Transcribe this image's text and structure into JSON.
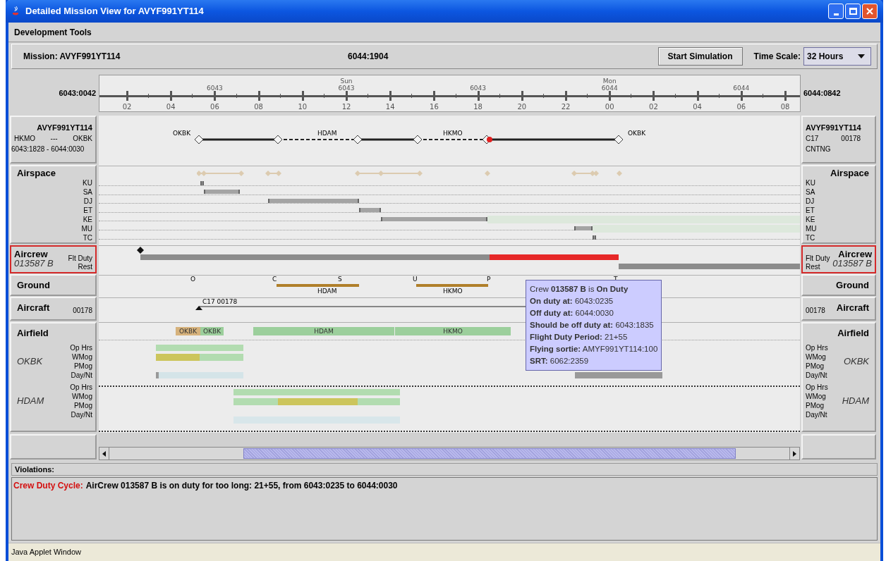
{
  "window": {
    "title": "Detailed Mission View for AVYF991YT114"
  },
  "menu_bar": [
    {
      "label": "Development Tools"
    }
  ],
  "mission_bar": {
    "mission": "Mission: AVYF991YT114",
    "current_time": "6044:1904",
    "start_button": "Start Simulation",
    "time_scale_label": "Time Scale:",
    "time_scale_value": "32 Hours"
  },
  "timeline": {
    "start": "6043:0042",
    "end": "6044:0842",
    "dates": [
      {
        "date": "6043"
      },
      {
        "weekday": "Sun",
        "date": "6043"
      },
      {
        "date": "6043"
      },
      {
        "weekday": "Mon",
        "date": "6044"
      },
      {
        "date": "6044"
      }
    ],
    "hours": [
      "02",
      "04",
      "06",
      "08",
      "10",
      "12",
      "14",
      "16",
      "18",
      "20",
      "22",
      "00",
      "02",
      "04",
      "06",
      "08"
    ]
  },
  "left_panel": {
    "mission": {
      "id": "AVYF991YT114",
      "origin": "HKMO",
      "separator": "---",
      "destination": "OKBK",
      "period": "6043:1828 - 6044:0030"
    },
    "airspace": {
      "title": "Airspace",
      "codes": [
        "KU",
        "SA",
        "DJ",
        "ET",
        "KE",
        "MU",
        "TC"
      ]
    },
    "aircrew": {
      "title": "Aircrew",
      "crew_id": "013587 B",
      "rows": [
        "Flt Duty",
        "Rest"
      ],
      "highlighted": true
    },
    "ground": {
      "title": "Ground"
    },
    "aircraft": {
      "title": "Aircraft",
      "tail": "00178"
    },
    "airfield": {
      "title": "Airfield",
      "fields": [
        {
          "name": "OKBK",
          "rows": [
            "Op Hrs",
            "WMog",
            "PMog",
            "Day/Nt"
          ]
        },
        {
          "name": "HDAM",
          "rows": [
            "Op Hrs",
            "WMog",
            "PMog",
            "Day/Nt"
          ]
        }
      ]
    }
  },
  "right_panel": {
    "mission": {
      "id": "AVYF991YT114",
      "type": "C17",
      "tail": "00178",
      "status": "CNTNG"
    },
    "airspace": {
      "title": "Airspace",
      "codes": [
        "KU",
        "SA",
        "DJ",
        "ET",
        "KE",
        "MU",
        "TC"
      ]
    },
    "aircrew": {
      "title": "Aircrew",
      "crew_id": "013587 B",
      "rows": [
        "Flt Duty",
        "Rest"
      ],
      "highlighted": true
    },
    "ground": {
      "title": "Ground"
    },
    "aircraft": {
      "title": "Aircraft",
      "tail": "00178"
    },
    "airfield": {
      "title": "Airfield",
      "fields": [
        {
          "name": "OKBK",
          "rows": [
            "Op Hrs",
            "WMog",
            "PMog",
            "Day/Nt"
          ]
        },
        {
          "name": "HDAM",
          "rows": [
            "Op Hrs",
            "WMog",
            "PMog",
            "Day/Nt"
          ]
        }
      ]
    }
  },
  "gantt": {
    "route_stops": [
      "OKBK",
      "HDAM",
      "HKMO",
      "OKBK"
    ],
    "ground_events": [
      "O",
      "C",
      "S",
      "U",
      "P",
      "T"
    ],
    "ground_stations": [
      "HDAM",
      "HKMO"
    ],
    "aircraft_label": "C17 00178",
    "airfield_tags": [
      {
        "label": "OKBK",
        "color": "#d6b27c"
      },
      {
        "label": "OKBK",
        "color": "#9ccf9c"
      },
      {
        "label": "HDAM",
        "color": "#9ccf9c"
      },
      {
        "label": "HKMO",
        "color": "#9ccf9c"
      }
    ]
  },
  "tooltip": {
    "lines": [
      "Crew **013587 B** is **On Duty**",
      "**On duty at:** 6043:0235",
      "**Off duty at:** 6044:0030",
      "**Should be off duty at:** 6043:1835",
      "**Flight Duty Period:** 21+55",
      "**Flying sortie:** AMYF991YT114:100",
      "**SRT:** 6062:2359"
    ]
  },
  "violations": {
    "title": "Violations:",
    "items": [
      {
        "category": "Crew Duty Cycle:",
        "message": "AirCrew 013587 B is on duty for too long: 21+55, from 6043:0235 to 6044:0030"
      }
    ]
  },
  "status_bar": "Java Applet Window"
}
